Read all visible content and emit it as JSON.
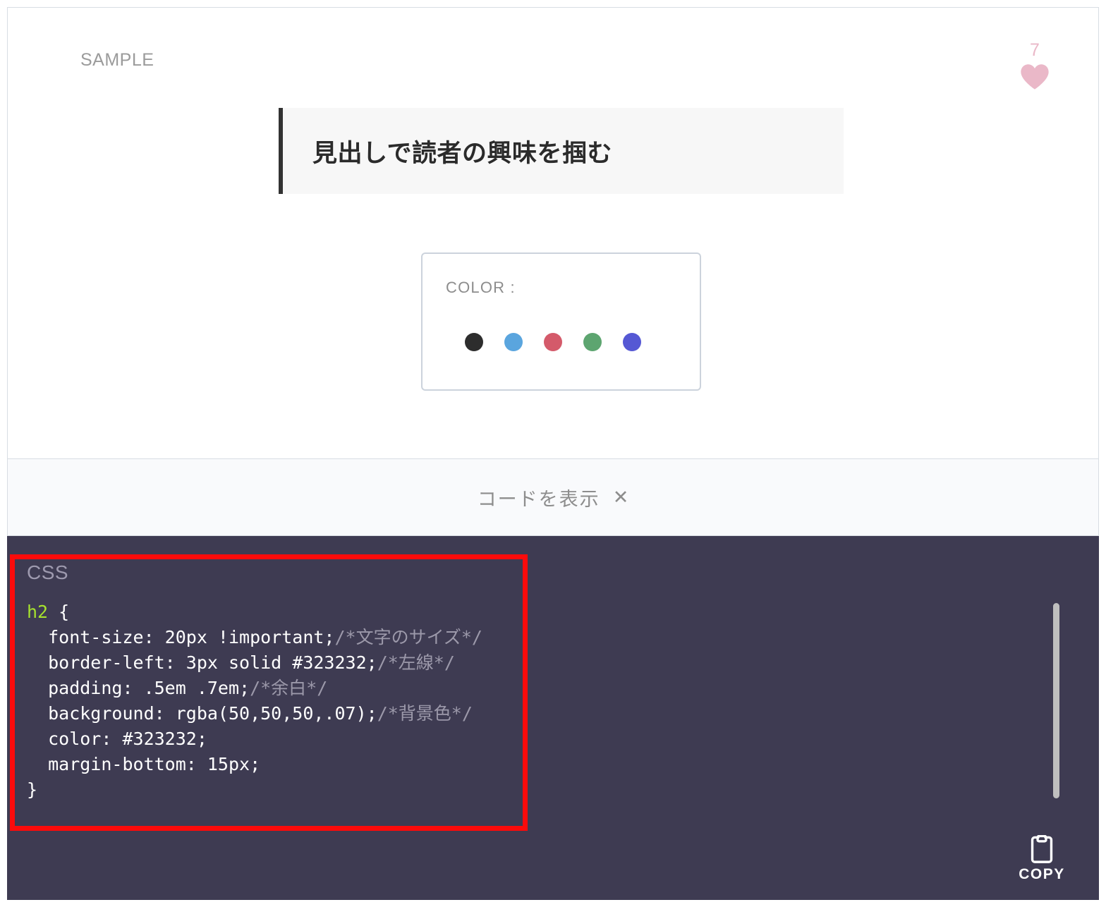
{
  "preview": {
    "sample_label": "SAMPLE",
    "like": {
      "count": "7",
      "icon": "heart-icon",
      "color": "#eab8c8"
    },
    "headline": {
      "text": "見出しで読者の興味を掴む",
      "border_color": "#323232",
      "background": "#f7f7f7"
    },
    "color_picker": {
      "label": "COLOR :",
      "swatches": [
        {
          "name": "black",
          "hex": "#2d2d2d"
        },
        {
          "name": "blue",
          "hex": "#5aa5de"
        },
        {
          "name": "red",
          "hex": "#d45a6a"
        },
        {
          "name": "green",
          "hex": "#5da570"
        },
        {
          "name": "purple",
          "hex": "#5558d4"
        }
      ]
    }
  },
  "toggle": {
    "label": "コードを表示",
    "close_icon": "✕"
  },
  "code_panel": {
    "language": "CSS",
    "background": "#3e3b52",
    "selector": "h2",
    "open_brace": " {",
    "close_brace": "}",
    "declarations": [
      {
        "prop": "  font-size: 20px !important;",
        "comment": "/*文字のサイズ*/"
      },
      {
        "prop": "  border-left: 3px solid #323232;",
        "comment": "/*左線*/"
      },
      {
        "prop": "  padding: .5em .7em;",
        "comment": "/*余白*/"
      },
      {
        "prop": "  background: rgba(50,50,50,.07);",
        "comment": "/*背景色*/"
      },
      {
        "prop": "  color: #323232;",
        "comment": ""
      },
      {
        "prop": "  margin-bottom: 15px;",
        "comment": ""
      }
    ],
    "copy": {
      "label": "COPY",
      "icon": "clipboard-icon"
    },
    "annotation": {
      "shape": "rectangle",
      "color": "#fb0b0b"
    }
  }
}
